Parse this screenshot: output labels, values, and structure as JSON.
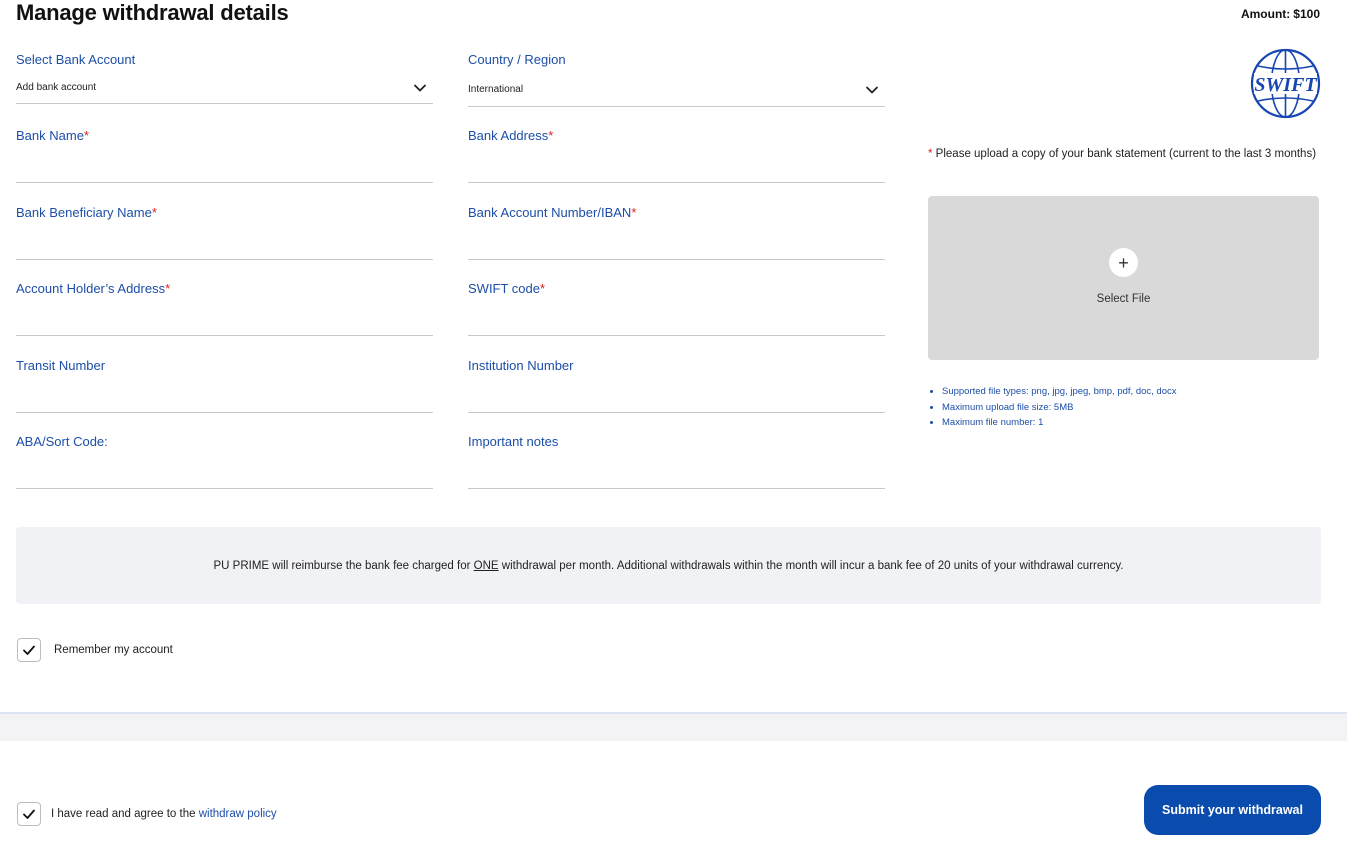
{
  "header": {
    "title": "Manage withdrawal details",
    "amount_label": "Amount:",
    "amount_value": "$100"
  },
  "form": {
    "select_bank_account": {
      "label": "Select Bank Account",
      "value": "Add bank account"
    },
    "country_region": {
      "label": "Country / Region",
      "value": "International"
    },
    "bank_name": {
      "label": "Bank Name",
      "required": "*"
    },
    "bank_address": {
      "label": "Bank Address",
      "required": "*"
    },
    "beneficiary_name": {
      "label": "Bank Beneficiary Name",
      "required": "*"
    },
    "account_number": {
      "label": "Bank Account Number/IBAN",
      "required": "*"
    },
    "holder_address": {
      "label": "Account Holder’s Address",
      "required": "*"
    },
    "swift_code": {
      "label": "SWIFT code",
      "required": "*"
    },
    "transit_number": {
      "label": "Transit Number"
    },
    "institution_number": {
      "label": "Institution Number"
    },
    "aba_sort_code": {
      "label": "ABA/Sort Code:"
    },
    "important_notes": {
      "label": "Important notes"
    }
  },
  "swift_logo_text": "SWIFT",
  "upload": {
    "required": "*",
    "note": " Please upload a copy of your bank statement (current to the last 3 months)",
    "plus": "+",
    "select_file": "Select File",
    "rules": [
      "Supported file types: png, jpg, jpeg, bmp, pdf, doc, docx",
      "Maximum upload file size: 5MB",
      "Maximum file number: 1"
    ]
  },
  "notice": {
    "before": "PU PRIME will reimburse the bank fee charged for ",
    "emphasis": "ONE",
    "after": " withdrawal per month. Additional withdrawals within the month will incur a bank fee of 20 units of your withdrawal currency."
  },
  "remember": {
    "label": "Remember my account",
    "checked": true
  },
  "agree": {
    "label": "I have read and agree to the ",
    "link": "withdraw policy",
    "checked": true
  },
  "submit_label": "Submit your withdrawal",
  "colors": {
    "accent": "#0a4cad",
    "label": "#1d4ea8",
    "required": "#e02020"
  }
}
